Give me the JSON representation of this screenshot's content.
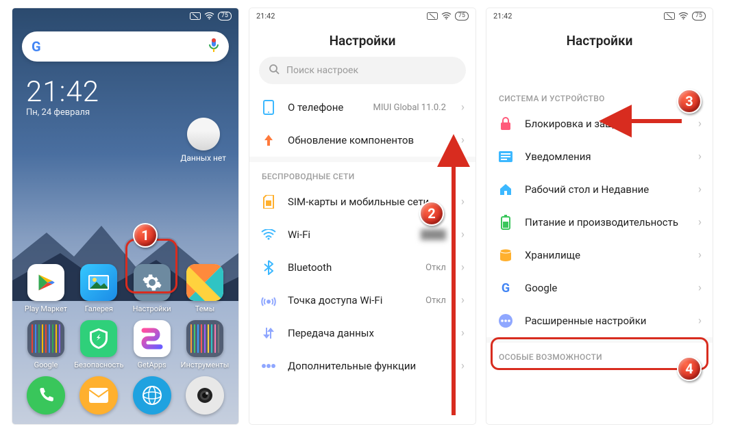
{
  "screen1": {
    "status_time": "",
    "status_battery": "75",
    "clock_time": "21:42",
    "clock_date": "Пн, 24 февраля",
    "weather_label": "Данных нет",
    "apps_row1": [
      {
        "name": "play-market",
        "label": "Play Маркет",
        "bg": "#ffffff"
      },
      {
        "name": "gallery",
        "label": "Галерея",
        "bg": "#3cb1ff"
      },
      {
        "name": "settings",
        "label": "Настройки",
        "bg": "#6d8aa0"
      },
      {
        "name": "themes",
        "label": "Темы",
        "bg": "#ffffff"
      }
    ],
    "apps_row2": [
      {
        "name": "google-folder",
        "label": "Google"
      },
      {
        "name": "security",
        "label": "Безопасность",
        "bg": "#2fd07a"
      },
      {
        "name": "getapps",
        "label": "GetApps",
        "bg": "linear-gradient(135deg,#ff4fa0,#6c5cff)"
      },
      {
        "name": "tools-folder",
        "label": "Инструменты"
      }
    ],
    "dock": [
      {
        "name": "phone",
        "bg": "#39c65b"
      },
      {
        "name": "messages",
        "bg": "#ffb02e"
      },
      {
        "name": "browser",
        "bg": "#1fa2e0"
      },
      {
        "name": "camera",
        "bg": "#e8e8e8"
      }
    ]
  },
  "screen2": {
    "status_time": "21:42",
    "status_battery": "75",
    "title": "Настройки",
    "search_placeholder": "Поиск настроек",
    "about_phone": "О телефоне",
    "about_phone_side": "MIUI Global 11.0.2",
    "update_components": "Обновление компонентов",
    "section_wireless": "БЕСПРОВОДНЫЕ СЕТИ",
    "sim": "SIM-карты и мобильные сети",
    "wifi": "Wi-Fi",
    "bluetooth": "Bluetooth",
    "bluetooth_side": "Откл",
    "hotspot": "Точка доступа Wi-Fi",
    "hotspot_side": "Откл",
    "data": "Передача данных",
    "more": "Дополнительные функции"
  },
  "screen3": {
    "status_time": "21:42",
    "status_battery": "75",
    "title": "Настройки",
    "section_system": "СИСТЕМА И УСТРОЙСТВО",
    "lock": "Блокировка и защита",
    "notifications": "Уведомления",
    "desktop": "Рабочий стол и Недавние",
    "power": "Питание и производительность",
    "storage": "Хранилище",
    "google": "Google",
    "advanced": "Расширенные настройки",
    "section_special": "ОСОБЫЕ ВОЗМОЖНОСТИ"
  },
  "badges": {
    "b1": "1",
    "b2": "2",
    "b3": "3",
    "b4": "4"
  }
}
